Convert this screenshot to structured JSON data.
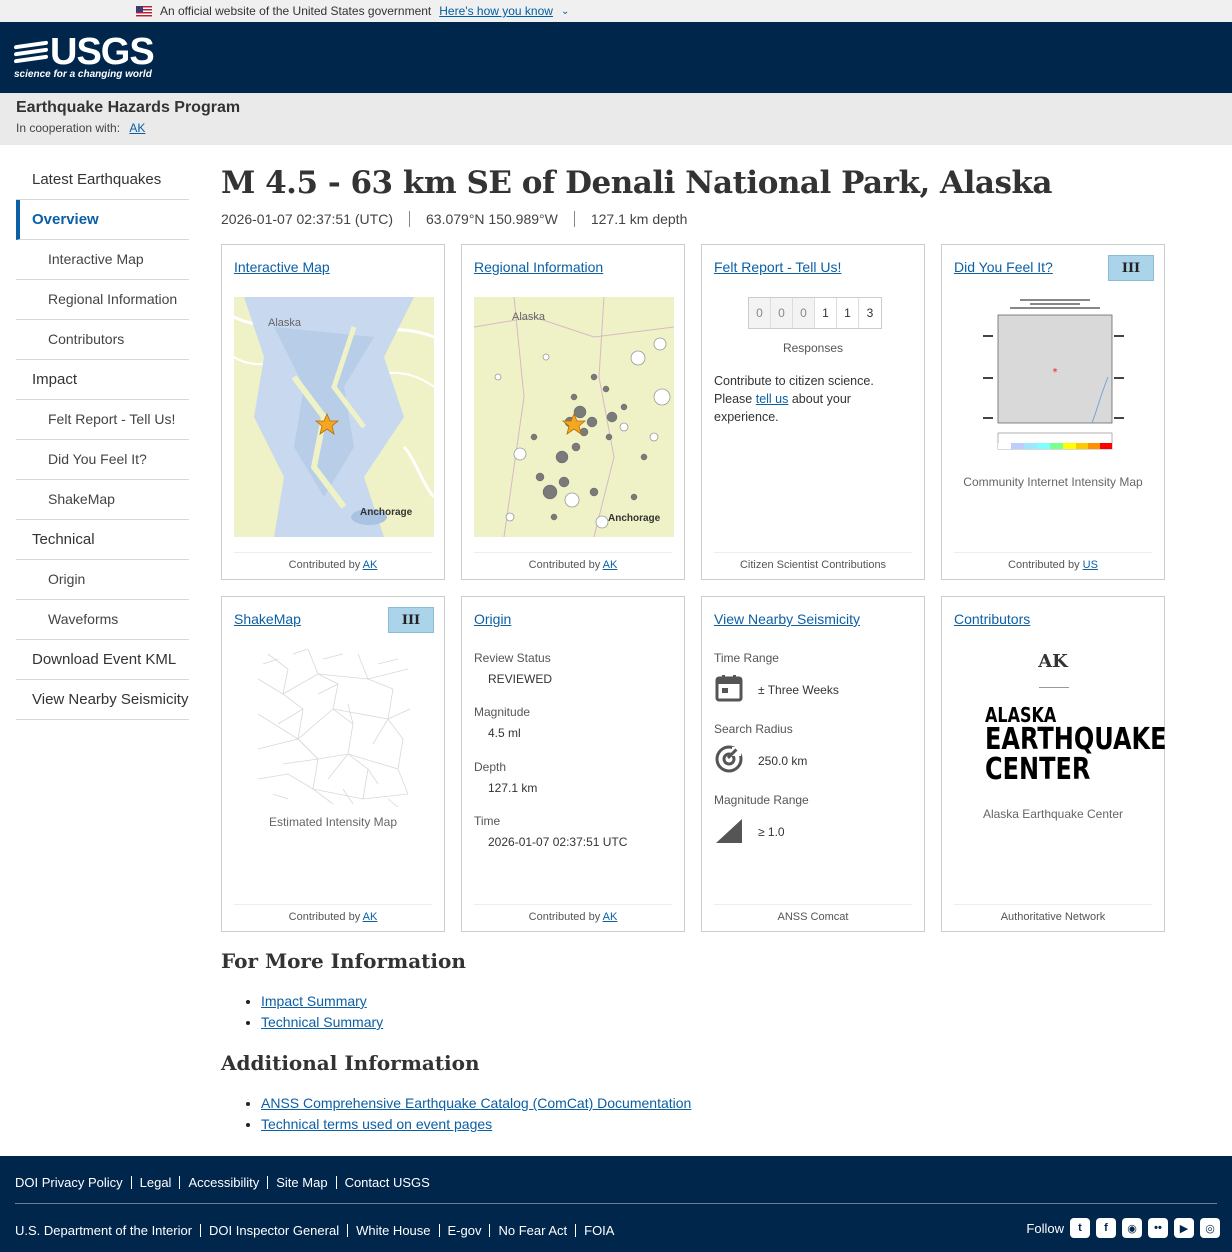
{
  "gov_banner": {
    "text": "An official website of the United States government",
    "link": "Here's how you know"
  },
  "header": {
    "logo_text": "USGS",
    "logo_tagline": "science for a changing world"
  },
  "program": {
    "title": "Earthquake Hazards Program",
    "coop_label": "In cooperation with:",
    "coop_link": "AK"
  },
  "sidebar": {
    "items": [
      {
        "label": "Latest Earthquakes"
      },
      {
        "label": "Overview"
      },
      {
        "label": "Interactive Map"
      },
      {
        "label": "Regional Information"
      },
      {
        "label": "Contributors"
      },
      {
        "label": "Impact"
      },
      {
        "label": "Felt Report - Tell Us!"
      },
      {
        "label": "Did You Feel It?"
      },
      {
        "label": "ShakeMap"
      },
      {
        "label": "Technical"
      },
      {
        "label": "Origin"
      },
      {
        "label": "Waveforms"
      },
      {
        "label": "Download Event KML"
      },
      {
        "label": "View Nearby Seismicity"
      }
    ]
  },
  "event": {
    "title": "M 4.5 - 63 km SE of Denali National Park, Alaska",
    "time": "2026-01-07 02:37:51 (UTC)",
    "location": "63.079°N 150.989°W",
    "depth": "127.1 km depth"
  },
  "cards": {
    "interactive_map": {
      "title": "Interactive Map",
      "contributed": "Contributed by",
      "contributor": "AK",
      "map_label_1": "Alaska",
      "map_label_2": "Anchorage"
    },
    "regional": {
      "title": "Regional Information",
      "contributed": "Contributed by",
      "contributor": "AK",
      "map_label_1": "Alaska",
      "map_label_2": "Anchorage"
    },
    "felt_report": {
      "title": "Felt Report - Tell Us!",
      "digits": [
        "0",
        "0",
        "0",
        "1",
        "1",
        "3"
      ],
      "responses_label": "Responses",
      "text_before": "Contribute to citizen science. Please",
      "link": "tell us",
      "text_after": "about your experience.",
      "footer": "Citizen Scientist Contributions"
    },
    "dyfi": {
      "title": "Did You Feel It?",
      "badge": "III",
      "caption": "Community Internet Intensity Map",
      "contributed": "Contributed by",
      "contributor": "US"
    },
    "shakemap": {
      "title": "ShakeMap",
      "badge": "III",
      "caption": "Estimated Intensity Map",
      "contributed": "Contributed by",
      "contributor": "AK"
    },
    "origin": {
      "title": "Origin",
      "fields": [
        {
          "label": "Review Status",
          "value": "REVIEWED"
        },
        {
          "label": "Magnitude",
          "value": "4.5 ml"
        },
        {
          "label": "Depth",
          "value": "127.1 km"
        },
        {
          "label": "Time",
          "value": "2026-01-07 02:37:51 UTC"
        }
      ],
      "contributed": "Contributed by",
      "contributor": "AK"
    },
    "seismicity": {
      "title": "View Nearby Seismicity",
      "time_label": "Time Range",
      "time_value": "± Three Weeks",
      "radius_label": "Search Radius",
      "radius_value": "250.0 km",
      "mag_label": "Magnitude Range",
      "mag_value": "≥ 1.0",
      "footer": "ANSS Comcat"
    },
    "contributors": {
      "title": "Contributors",
      "code": "AK",
      "logo_line1": "ALASKA",
      "logo_line2": "EARTHQUAKE",
      "logo_line3": "CENTER",
      "name": "Alaska Earthquake Center",
      "footer": "Authoritative Network"
    }
  },
  "more_info": {
    "title": "For More Information",
    "links": [
      "Impact Summary",
      "Technical Summary"
    ]
  },
  "additional_info": {
    "title": "Additional Information",
    "links": [
      "ANSS Comprehensive Earthquake Catalog (ComCat) Documentation",
      "Technical terms used on event pages"
    ]
  },
  "footer": {
    "row1": [
      "DOI Privacy Policy",
      "Legal",
      "Accessibility",
      "Site Map",
      "Contact USGS"
    ],
    "row2": [
      "U.S. Department of the Interior",
      "DOI Inspector General",
      "White House",
      "E-gov",
      "No Fear Act",
      "FOIA"
    ],
    "follow": "Follow",
    "social_icons": [
      "twitter-icon",
      "facebook-icon",
      "github-icon",
      "flickr-icon",
      "youtube-icon",
      "instagram-icon"
    ]
  },
  "colors": {
    "header_bg": "#00264c",
    "link": "#0b5fa5",
    "badge": "#abd3ea",
    "epicenter": "#f5a623"
  }
}
